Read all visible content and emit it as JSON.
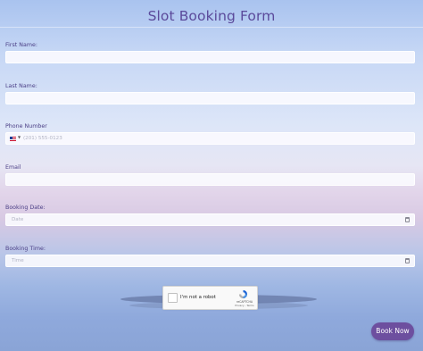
{
  "form": {
    "title": "Slot Booking Form",
    "fields": {
      "first_name": {
        "label": "First Name:",
        "value": ""
      },
      "last_name": {
        "label": "Last Name:",
        "value": ""
      },
      "phone": {
        "label": "Phone Number",
        "placeholder": "(201) 555-0123",
        "country": "US"
      },
      "email": {
        "label": "Email",
        "value": ""
      },
      "booking_date": {
        "label": "Booking Date:",
        "placeholder": "Date"
      },
      "booking_time": {
        "label": "Booking Time:",
        "placeholder": "Time"
      }
    },
    "captcha": {
      "label": "I'm not a robot",
      "brand": "reCAPTCHA",
      "links": "Privacy - Terms"
    },
    "submit_label": "Book Now"
  },
  "colors": {
    "title": "#5b4a9b",
    "label": "#4b3f86",
    "button": "#6d4f9f",
    "captcha_logo": "#1c64d6"
  },
  "icons": [
    "us-flag-icon",
    "chevron-down-icon",
    "calendar-icon",
    "recaptcha-logo-icon"
  ]
}
